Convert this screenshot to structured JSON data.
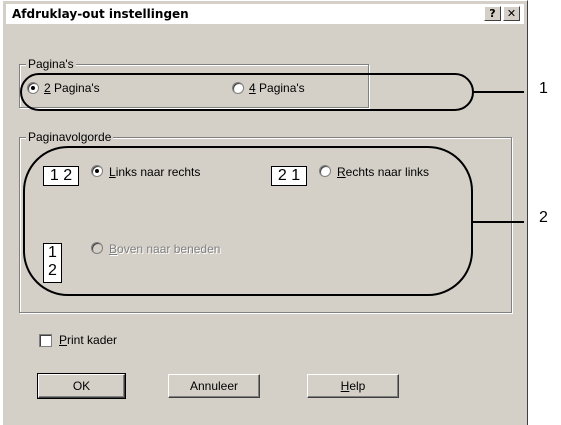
{
  "window": {
    "title": "Afdruklay-out instellingen",
    "help_button": "?",
    "close_button": "✕"
  },
  "pages_group": {
    "label": "Pagina's",
    "options": [
      {
        "label": "2 Pagina's",
        "mnemonic": "2",
        "rest": " Pagina's",
        "checked": true
      },
      {
        "label": "4 Pagina's",
        "mnemonic": "4",
        "rest": " Pagina's",
        "checked": false
      }
    ]
  },
  "order_group": {
    "label": "Paginavolgorde",
    "options": [
      {
        "label": "Links naar rechts",
        "mnemonic": "L",
        "rest": "inks naar rechts",
        "icon": [
          "1",
          "2"
        ],
        "checked": true,
        "enabled": true
      },
      {
        "label": "Rechts naar links",
        "mnemonic": "R",
        "rest": "echts naar links",
        "icon": [
          "2",
          "1"
        ],
        "checked": false,
        "enabled": true
      },
      {
        "label": "Boven naar beneden",
        "mnemonic": "B",
        "rest": "oven naar beneden",
        "icon": [
          "1",
          "2"
        ],
        "checked": false,
        "enabled": false
      }
    ]
  },
  "print_frame": {
    "label": "Print kader",
    "mnemonic": "P",
    "rest": "rint kader",
    "checked": false
  },
  "buttons": {
    "ok": "OK",
    "cancel": "Annuleer",
    "help": "Help",
    "help_mnemonic": "H",
    "help_rest": "elp"
  },
  "callouts": {
    "one": "1",
    "two": "2"
  }
}
